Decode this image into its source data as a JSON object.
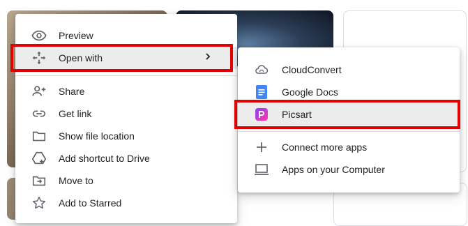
{
  "main_menu": {
    "items": [
      {
        "label": "Preview",
        "icon": "eye-icon"
      },
      {
        "label": "Open with",
        "icon": "move-arrows-icon"
      },
      {
        "label": "Share",
        "icon": "person-add-icon"
      },
      {
        "label": "Get link",
        "icon": "link-icon"
      },
      {
        "label": "Show file location",
        "icon": "folder-icon"
      },
      {
        "label": "Add shortcut to Drive",
        "icon": "add-shortcut-icon"
      },
      {
        "label": "Move to",
        "icon": "move-to-folder-icon"
      },
      {
        "label": "Add to Starred",
        "icon": "star-icon"
      }
    ]
  },
  "sub_menu": {
    "items": [
      {
        "label": "CloudConvert",
        "icon": "cloudconvert-icon"
      },
      {
        "label": "Google Docs",
        "icon": "google-docs-icon"
      },
      {
        "label": "Picsart",
        "icon": "picsart-icon"
      },
      {
        "label": "Connect more apps",
        "icon": "plus-icon"
      },
      {
        "label": "Apps on your Computer",
        "icon": "laptop-icon"
      }
    ]
  },
  "colors": {
    "highlight_border": "#e00000",
    "hover_bg": "#ececec",
    "docs_blue": "#4285f4",
    "picsart_gradient": [
      "#8a3ffc",
      "#ff3aa3"
    ]
  }
}
